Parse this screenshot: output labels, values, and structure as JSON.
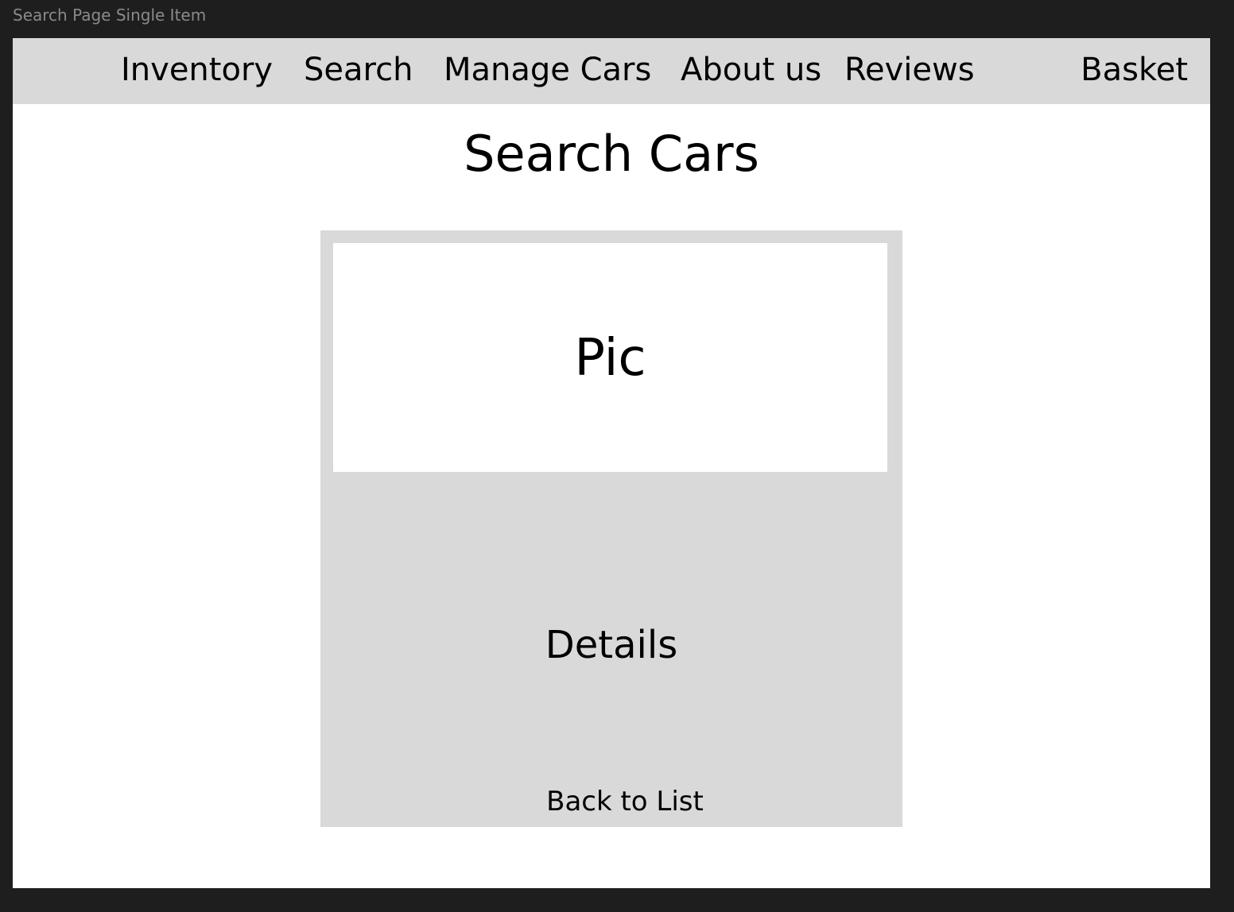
{
  "window": {
    "frame_title": "Search Page Single Item"
  },
  "navbar": {
    "items": [
      {
        "label": "Inventory"
      },
      {
        "label": "Search"
      },
      {
        "label": "Manage Cars"
      },
      {
        "label": "About us"
      },
      {
        "label": "Reviews"
      }
    ],
    "basket_label": "Basket"
  },
  "main": {
    "title": "Search Cars",
    "card": {
      "pic_label": "Pic",
      "details_label": "Details",
      "back_label": "Back to List"
    }
  },
  "colors": {
    "canvas_background": "#1e1e1e",
    "frame_background": "#ffffff",
    "navbar_background": "#d9d9d9",
    "card_background": "#d9d9d9",
    "frame_title_text": "#8a8a8a",
    "text": "#000000"
  }
}
